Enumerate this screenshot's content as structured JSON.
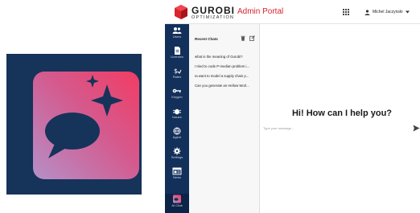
{
  "brand": {
    "name": "GUROBI",
    "tagline": "OPTIMIZATION",
    "portal_title": "Admin Portal"
  },
  "user": {
    "name": "Michel Jaczynski"
  },
  "nav": [
    {
      "label": "Users",
      "icon": "users-icon"
    },
    {
      "label": "Licenses",
      "icon": "license-icon"
    },
    {
      "label": "Rates",
      "icon": "rates-icon"
    },
    {
      "label": "Keygen",
      "icon": "key-icon"
    },
    {
      "label": "Issues",
      "icon": "bug-icon"
    },
    {
      "label": "Agent",
      "icon": "agent-icon"
    },
    {
      "label": "Settings",
      "icon": "gear-icon"
    },
    {
      "label": "News",
      "icon": "news-icon"
    },
    {
      "label": "AI Chat",
      "icon": "ai-chat-icon"
    }
  ],
  "chat_list": {
    "title": "Recent Chats",
    "items": [
      "what is the meaning of Gurobi?",
      "I tried to code P-median problem i...",
      "Iа want to model a supply chain p...",
      "Can you generate an Hellow Worl..."
    ]
  },
  "main": {
    "greeting": "Hi! How can I help you?",
    "input_placeholder": "Type your message..."
  },
  "colors": {
    "sidebar": "#12305a",
    "brand_red": "#d9232d",
    "logo_tile": "#16335a"
  }
}
